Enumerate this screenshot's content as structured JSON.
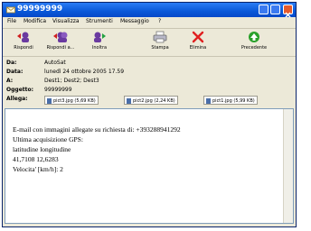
{
  "window": {
    "title": "99999999"
  },
  "menu": [
    "File",
    "Modifica",
    "Visualizza",
    "Strumenti",
    "Messaggio",
    "?"
  ],
  "toolbar": [
    {
      "label": "Rispondi",
      "icon": "reply-icon"
    },
    {
      "label": "Rispondi a...",
      "icon": "reply-all-icon"
    },
    {
      "label": "Inoltra",
      "icon": "forward-icon"
    },
    {
      "label": "Stampa",
      "icon": "print-icon"
    },
    {
      "label": "Elimina",
      "icon": "delete-icon"
    },
    {
      "label": "Precedente",
      "icon": "previous-icon"
    }
  ],
  "headers": {
    "from": {
      "label": "Da:",
      "value": "AutoSat"
    },
    "date": {
      "label": "Data:",
      "value": "lunedì 24 ottobre 2005 17.59"
    },
    "to": {
      "label": "A:",
      "value": "Dest1; Dest2; Dest3"
    },
    "subject": {
      "label": "Oggetto:",
      "value": "99999999"
    },
    "attachments_label": "Allega:",
    "attachments": [
      "pict3.jpg (5,69 KB)",
      "pict2.jpg (2,24 KB)",
      "pict1.jpg (5,99 KB)"
    ]
  },
  "body": {
    "lines": [
      "E-mail con immagini allegate su richiesta di: +393288941292",
      "Ultima acquisizione GPS:",
      "latitudine longitudine",
      "41,7108 12,6283",
      "Velocita' [km/h]: 2"
    ]
  },
  "colors": {
    "titlebar": "#0a58d8",
    "chrome": "#ece9d8",
    "delete": "#e02020",
    "previous": "#2aa02a"
  }
}
